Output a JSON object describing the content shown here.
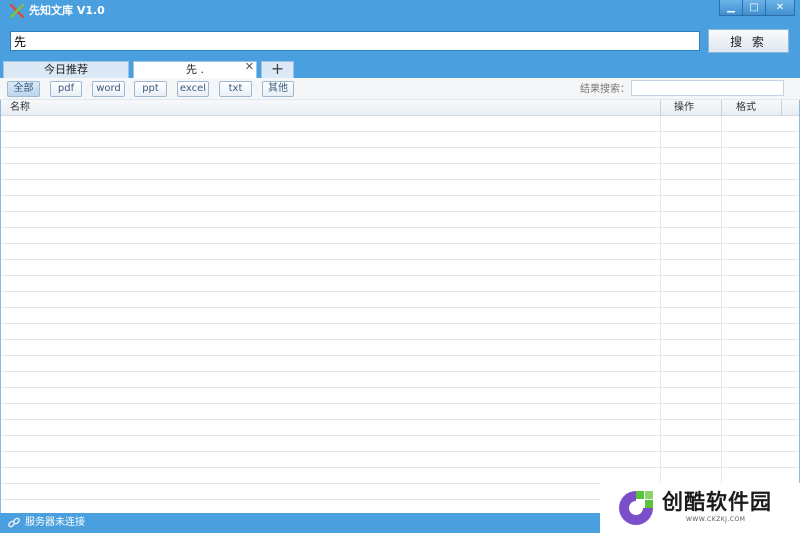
{
  "app": {
    "title": "先知文库 V1.0"
  },
  "window_controls": {
    "minimize": "▁",
    "maximize": "□",
    "close": "✕"
  },
  "search": {
    "value": "先",
    "button_label": "搜 索"
  },
  "tabs": [
    {
      "label": "今日推荐"
    },
    {
      "label": "先 .",
      "close": "✕"
    },
    {
      "label": "+"
    }
  ],
  "filters": {
    "buttons": [
      "全部",
      "pdf",
      "word",
      "ppt",
      "excel",
      "txt",
      "其他"
    ],
    "active": "全部",
    "result_search_label": "结果搜索：",
    "result_search_value": ""
  },
  "table": {
    "columns": [
      "名称",
      "操作",
      "格式"
    ],
    "rows": []
  },
  "status": {
    "text": "服务器未连接",
    "icon": "link-icon"
  },
  "watermark": {
    "title": "创酷软件园",
    "url": "WWW.CKZKJ.COM"
  },
  "colors": {
    "accent": "#4a9fde",
    "watermark_green": "#5ac23b",
    "watermark_purple": "#7a4fc9"
  }
}
